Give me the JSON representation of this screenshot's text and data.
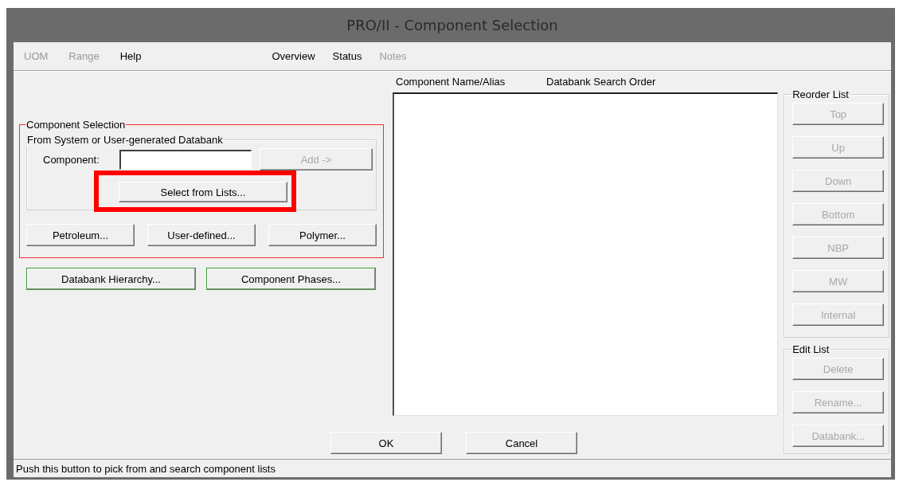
{
  "window": {
    "title": "PRO/II - Component Selection"
  },
  "menu": {
    "left": [
      {
        "label": "UOM",
        "disabled": true
      },
      {
        "label": "Range",
        "disabled": true
      },
      {
        "label": "Help",
        "disabled": false
      }
    ],
    "right": [
      {
        "label": "Overview",
        "disabled": false
      },
      {
        "label": "Status",
        "disabled": false
      },
      {
        "label": "Notes",
        "disabled": true
      }
    ]
  },
  "component_selection": {
    "title": "Component Selection",
    "databank_group": {
      "title": "From System or User-generated Databank",
      "component_label": "Component:",
      "add_button": {
        "label": "Add ->",
        "disabled": true
      },
      "select_button": {
        "label": "Select from Lists...",
        "disabled": false,
        "highlighted": true
      }
    },
    "buttons": [
      {
        "label": "Petroleum...",
        "disabled": false
      },
      {
        "label": "User-defined...",
        "disabled": false
      },
      {
        "label": "Polymer...",
        "disabled": false
      }
    ]
  },
  "extra_buttons": [
    {
      "label": "Databank Hierarchy...",
      "disabled": false,
      "color": "#3c9a3c"
    },
    {
      "label": "Component Phases...",
      "disabled": false,
      "color": "#3c9a3c"
    }
  ],
  "component_list": {
    "columns": [
      "Component Name/Alias",
      "Databank Search Order"
    ]
  },
  "reorder_list": {
    "title": "Reorder List",
    "buttons": [
      {
        "label": "Top",
        "disabled": true
      },
      {
        "label": "Up",
        "disabled": true
      },
      {
        "label": "Down",
        "disabled": true
      },
      {
        "label": "Bottom",
        "disabled": true
      },
      {
        "label": "NBP",
        "disabled": true
      },
      {
        "label": "MW",
        "disabled": true
      },
      {
        "label": "Internal",
        "disabled": true
      }
    ]
  },
  "edit_list": {
    "title": "Edit List",
    "buttons": [
      {
        "label": "Delete",
        "disabled": true
      },
      {
        "label": "Rename...",
        "disabled": true
      },
      {
        "label": "Databank...",
        "disabled": true
      }
    ]
  },
  "dialog_buttons": [
    {
      "label": "OK",
      "disabled": false
    },
    {
      "label": "Cancel",
      "disabled": false
    }
  ],
  "status_bar": "Push this button to pick from and search component lists"
}
